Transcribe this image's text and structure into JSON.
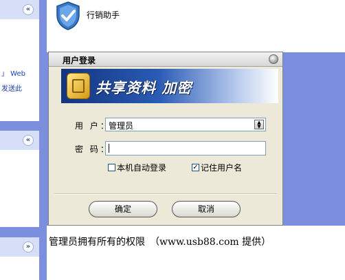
{
  "left_pane": {
    "panel1": {
      "text_line1": "」 Web",
      "text_line2": "发送此"
    },
    "collapse_up_1": "«",
    "collapse_up_2": "«",
    "collapse_down": "»"
  },
  "top": {
    "app_title": "行销助手",
    "icon": "shield-check-icon"
  },
  "dialog": {
    "title": "用户登录",
    "banner_text": "共享资料 加密",
    "username_label": "用 户：",
    "username_value": "管理员",
    "password_label": "密 码：",
    "password_value": "",
    "auto_login_label": "本机自动登录",
    "auto_login_checked": false,
    "remember_user_label": "记住用户名",
    "remember_user_checked": true,
    "ok_label": "确定",
    "cancel_label": "取消"
  },
  "footer": {
    "note": "管理员拥有所有的权限　（www.usb88.com 提供）"
  },
  "colors": {
    "desktop_bg": "#7b8fde",
    "dialog_bg": "#ece9d8",
    "banner_dark": "#13357f"
  }
}
